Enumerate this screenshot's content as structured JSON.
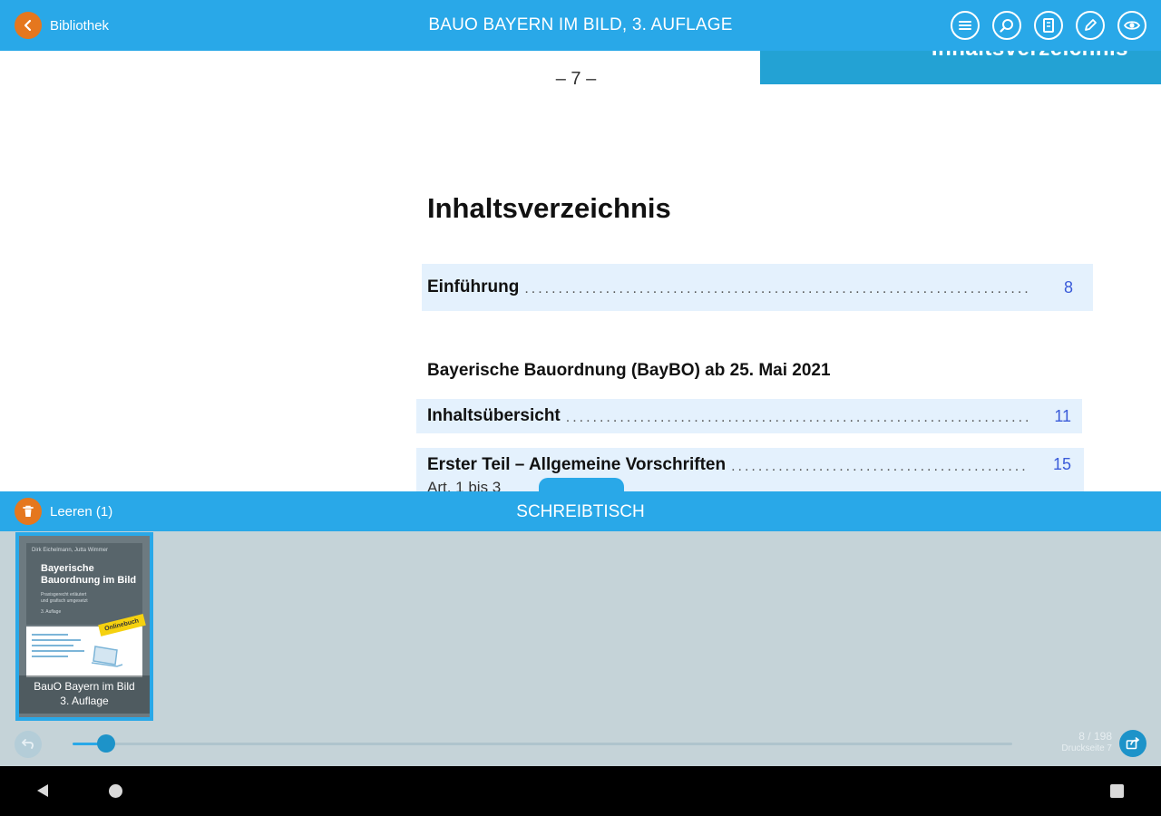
{
  "topbar": {
    "back_label": "Bibliothek",
    "title": "BAUO BAYERN IM BILD, 3. AUFLAGE",
    "tools": [
      {
        "name": "toc-icon"
      },
      {
        "name": "search-icon"
      },
      {
        "name": "notes-icon"
      },
      {
        "name": "pen-icon"
      },
      {
        "name": "eye-icon"
      }
    ]
  },
  "page": {
    "corner_tab": "Inhaltsverzeichnis",
    "number": "– 7 –",
    "heading": "Inhaltsverzeichnis",
    "entries": [
      {
        "label": "Einführung",
        "page": "8"
      },
      {
        "label": "Inhaltsübersicht",
        "page": "11"
      },
      {
        "label": "Erster Teil – Allgemeine Vorschriften",
        "page": "15"
      }
    ],
    "section_heading": "Bayerische Bauordnung (BayBO) ab 25. Mai 2021",
    "sub_text": "Art. 1 bis 3"
  },
  "desk": {
    "empty_label": "Leeren (1)",
    "title": "SCHREIBTISCH",
    "book": {
      "title_line1": "BauO Bayern im Bild",
      "title_line2": "3. Auflage",
      "cover_authors": "Dirk Eichelmann, Jutta Wimmer",
      "cover_title_1": "Bayerische",
      "cover_title_2": "Bauordnung im Bild",
      "cover_subtitle_1": "Praxisgerecht erläutert",
      "cover_subtitle_2": "und grafisch umgesetzt",
      "cover_edition": "3. Auflage",
      "cover_badge": "Onlinebuch"
    },
    "progress": 0.036,
    "page_count": "8 / 198",
    "print_page": "Druckseite 7"
  },
  "colors": {
    "primary": "#29a8e8",
    "accent": "#e5771e",
    "desk_bg": "#c5d3d8",
    "link": "#3a5bd9"
  }
}
